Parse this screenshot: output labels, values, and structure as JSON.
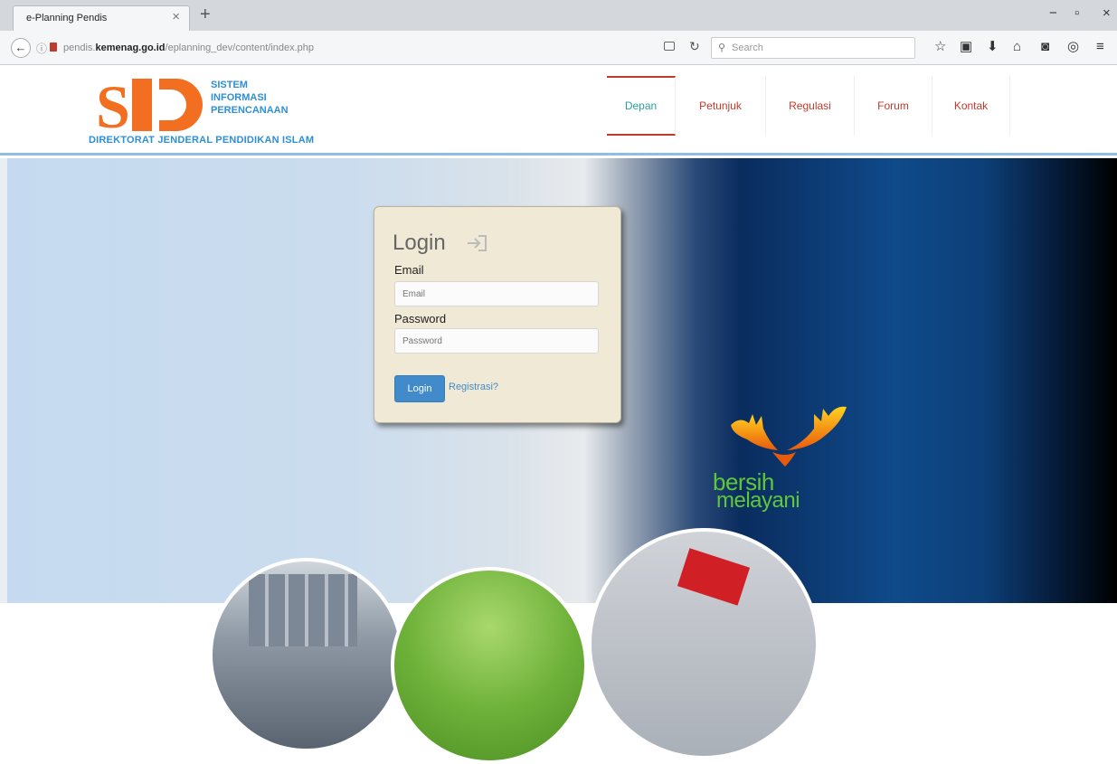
{
  "browser": {
    "tab_title": "e-Planning Pendis",
    "tab_close": "×",
    "new_tab": "+",
    "url_prefix": "pendis.",
    "url_domain": "kemenag.go.id",
    "url_path": "/eplanning_dev/content/index.php",
    "search_placeholder": "Search",
    "window_controls": [
      "−",
      "▫",
      "×"
    ]
  },
  "site": {
    "logo_letters": "SIP",
    "logo_lines": [
      "SISTEM",
      "INFORMASI",
      "PERENCANAAN"
    ],
    "logo_subtitle": "DIREKTORAT JENDERAL PENDIDIKAN ISLAM",
    "menu": [
      "Depan",
      "Petunjuk",
      "Regulasi",
      "Forum",
      "Kontak"
    ]
  },
  "login": {
    "title": "Login",
    "email_label": "Email",
    "email_placeholder": "Email",
    "password_label": "Password",
    "password_placeholder": "Password",
    "button_label": "Login",
    "register_link": "Registrasi?"
  },
  "banner": {
    "tagline_1": "bersih",
    "tagline_2": "melayani"
  },
  "colors": {
    "brand_orange": "#f26f21",
    "brand_blue": "#2e8fd6",
    "menu_red": "#c0392b",
    "menu_active": "#2aa1a1",
    "button_blue": "#428bca",
    "tagline_green": "#5fc838"
  }
}
